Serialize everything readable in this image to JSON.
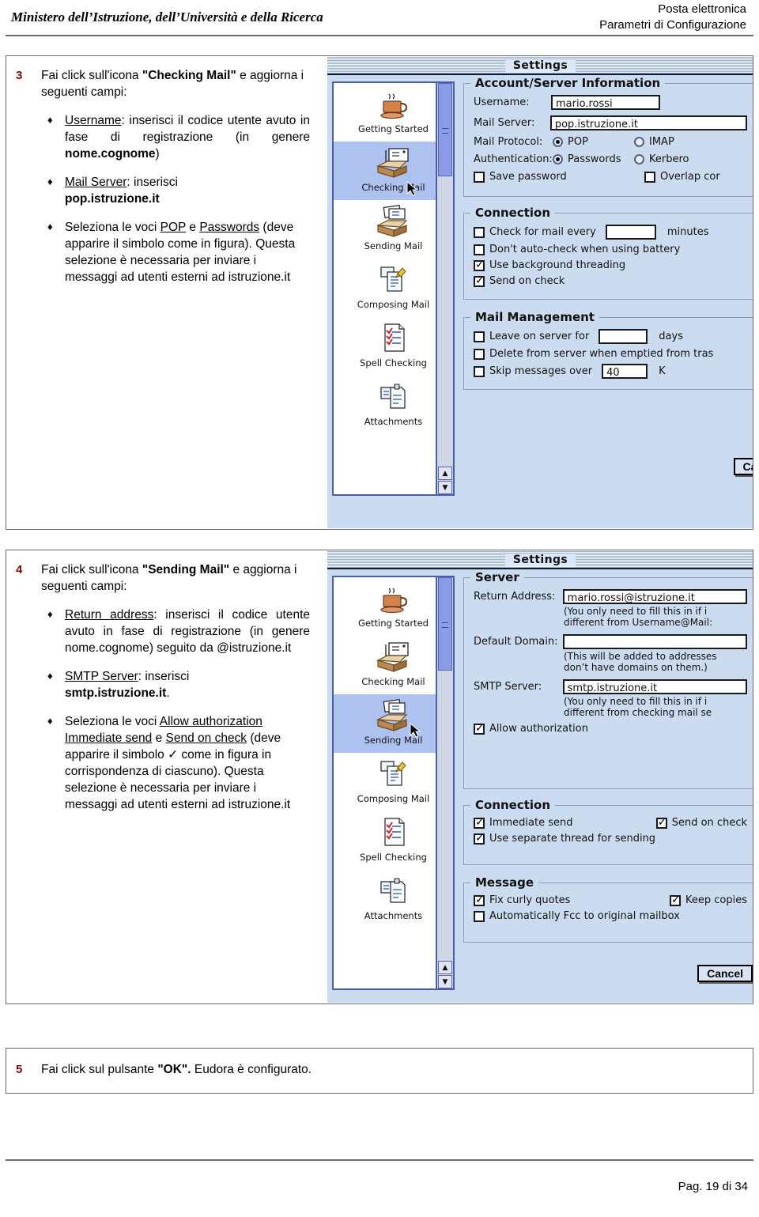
{
  "header": {
    "left_title": "Ministero dell’Istruzione, dell’Università e della Ricerca",
    "right_line1": "Posta elettronica",
    "right_line2": "Parametri di Configurazione"
  },
  "footer": {
    "page_label": "Pag. 19 di 34"
  },
  "steps": {
    "step3": {
      "number": "3",
      "intro_plain1": "Fai click sull'icona ",
      "intro_bold": "\"Checking Mail\"",
      "intro_plain2": " e aggiorna i seguenti campi:",
      "bullets": [
        {
          "link": "Username",
          "text_a": ": inserisci il codice utente avuto in fase di registrazione (in genere ",
          "bold_b": "nome.cognome",
          "text_c": ")"
        },
        {
          "link": "Mail Server",
          "text_a": ": inserisci ",
          "bold_b": "pop.istruzione.it",
          "text_c": ""
        },
        {
          "pre": "Seleziona le voci ",
          "link1": "POP",
          "mid": " e ",
          "link2": "Passwords",
          "post": " (deve apparire il simbolo come in figura). Questa selezione è necessaria per inviare i messaggi ad utenti esterni ad istruzione.it"
        }
      ]
    },
    "step4": {
      "number": "4",
      "intro_plain1": "Fai click sull'icona ",
      "intro_bold": "\"Sending Mail\"",
      "intro_plain2": " e aggiorna i seguenti campi:",
      "bullets": [
        {
          "link": "Return address",
          "text_a": ": inserisci il codice utente avuto in fase di registrazione (in genere nome.cognome) seguito da @istruzione.it"
        },
        {
          "link": "SMTP Server",
          "text_a": ": inserisci ",
          "bold_b": "smtp.istruzione.it",
          "text_c": "."
        },
        {
          "pre": "Seleziona le voci ",
          "link1": "Allow authorization",
          "link2": "Immediate send",
          "mid": " e ",
          "link3": "Send on check",
          "post": " (deve apparire il simbolo ✓ come in figura in corrispondenza di ciascuno). Questa selezione è necessaria per inviare i messaggi ad utenti esterni ad istruzione.it"
        }
      ]
    },
    "step5": {
      "number": "5",
      "plain1": "Fai click sul pulsante ",
      "bold": "\"OK\".",
      "plain2": " Eudora è configurato."
    }
  },
  "dialog_checking": {
    "window_title": "Settings",
    "sidebar": [
      {
        "label": "Getting Started",
        "icon": "coffee-cup-icon",
        "selected": false
      },
      {
        "label": "Checking Mail",
        "icon": "inbox-icon",
        "selected": true
      },
      {
        "label": "Sending Mail",
        "icon": "outbox-icon",
        "selected": false
      },
      {
        "label": "Composing Mail",
        "icon": "pencil-note-icon",
        "selected": false
      },
      {
        "label": "Spell Checking",
        "icon": "checklist-icon",
        "selected": false
      },
      {
        "label": "Attachments",
        "icon": "clipboard-icon",
        "selected": false
      }
    ],
    "groups": {
      "account": {
        "title": "Account/Server Information",
        "username_label": "Username:",
        "username_value": "mario.rossi",
        "mailserver_label": "Mail Server:",
        "mailserver_value": "pop.istruzione.it",
        "protocol_label": "Mail Protocol:",
        "protocol_pop": "POP",
        "protocol_pop_on": true,
        "protocol_imap": "IMAP",
        "protocol_imap_on": false,
        "auth_label": "Authentication:",
        "auth_passwords": "Passwords",
        "auth_passwords_on": true,
        "auth_kerberos": "Kerbero",
        "auth_kerberos_on": false,
        "save_password": "Save password",
        "save_password_on": false,
        "overlap": "Overlap cor",
        "overlap_on": false
      },
      "connection": {
        "title": "Connection",
        "rows": [
          {
            "label": "Check for mail every",
            "checked": false,
            "field": "",
            "suffix": "minutes"
          },
          {
            "label": "Don't auto-check when using battery",
            "checked": false
          },
          {
            "label": "Use background threading",
            "checked": true
          },
          {
            "label": "Send on check",
            "checked": true
          }
        ]
      },
      "mailmgmt": {
        "title": "Mail Management",
        "rows": [
          {
            "label": "Leave on server for",
            "checked": false,
            "field": "",
            "suffix": "days"
          },
          {
            "label": "Delete from server when emptied from tras",
            "checked": false
          },
          {
            "label": "Skip messages over",
            "checked": false,
            "field": "40",
            "suffix": "K"
          }
        ]
      }
    },
    "cancel_button": "Can"
  },
  "dialog_sending": {
    "window_title": "Settings",
    "sidebar": [
      {
        "label": "Getting Started",
        "icon": "coffee-cup-icon",
        "selected": false
      },
      {
        "label": "Checking Mail",
        "icon": "inbox-icon",
        "selected": false
      },
      {
        "label": "Sending Mail",
        "icon": "outbox-icon",
        "selected": true
      },
      {
        "label": "Composing Mail",
        "icon": "pencil-note-icon",
        "selected": false
      },
      {
        "label": "Spell Checking",
        "icon": "checklist-icon",
        "selected": false
      },
      {
        "label": "Attachments",
        "icon": "clipboard-icon",
        "selected": false
      }
    ],
    "groups": {
      "server": {
        "title": "Server",
        "return_label": "Return Address:",
        "return_value": "mario.rossi@istruzione.it",
        "return_hint1": "(You only need to fill this in if i",
        "return_hint2": "different from Username@Mail:",
        "domain_label": "Default Domain:",
        "domain_value": "",
        "domain_hint1": "(This will be added to addresses",
        "domain_hint2": "don’t have domains on them.)",
        "smtp_label": "SMTP Server:",
        "smtp_value": "smtp.istruzione.it",
        "smtp_hint1": "(You only need to fill this in if i",
        "smtp_hint2": "different from checking mail se",
        "allow_auth": "Allow authorization",
        "allow_auth_on": true
      },
      "connection": {
        "title": "Connection",
        "immediate_send": "Immediate send",
        "immediate_send_on": true,
        "send_on_check": "Send on check",
        "send_on_check_on": true,
        "separate_thread": "Use separate thread for sending",
        "separate_thread_on": true
      },
      "message": {
        "title": "Message",
        "fix_quotes": "Fix curly quotes",
        "fix_quotes_on": true,
        "keep_copies": "Keep copies",
        "keep_copies_on": true,
        "auto_fcc": "Automatically Fcc to original mailbox",
        "auto_fcc_on": false
      }
    },
    "cancel_button": "Cancel"
  }
}
